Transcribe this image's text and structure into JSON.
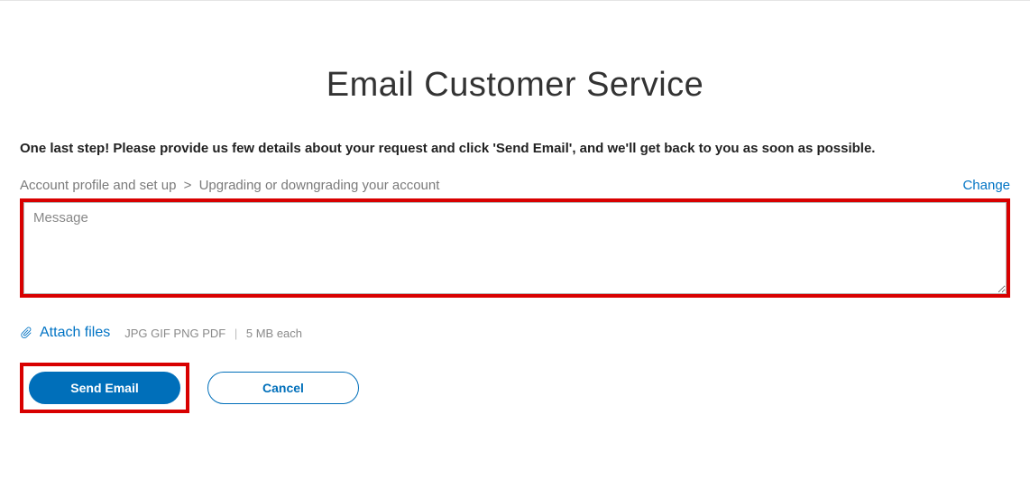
{
  "page": {
    "title": "Email Customer Service",
    "instruction": "One last step! Please provide us few details about your request and click 'Send Email', and we'll get back to you as soon as possible."
  },
  "breadcrumb": {
    "level1": "Account profile and set up",
    "separator": ">",
    "level2": "Upgrading or downgrading your account",
    "change_label": "Change"
  },
  "form": {
    "message_placeholder": "Message",
    "message_value": ""
  },
  "attach": {
    "link_label": "Attach files",
    "formats": "JPG GIF PNG PDF",
    "pipe": "|",
    "size_hint": "5 MB each"
  },
  "buttons": {
    "send_label": "Send Email",
    "cancel_label": "Cancel"
  }
}
